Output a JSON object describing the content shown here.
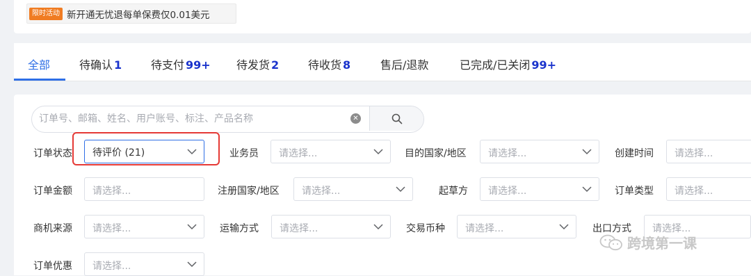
{
  "promo": {
    "badge": "限时活动",
    "text": "新开通无忧退每单保费仅0.01美元"
  },
  "tabs": [
    {
      "label": "全部",
      "count": ""
    },
    {
      "label": "待确认",
      "count": "1"
    },
    {
      "label": "待支付",
      "count": "99+"
    },
    {
      "label": "待发货",
      "count": "2"
    },
    {
      "label": "待收货",
      "count": "8"
    },
    {
      "label": "售后/退款",
      "count": ""
    },
    {
      "label": "已完成/已关闭",
      "count": "99+"
    }
  ],
  "search": {
    "placeholder": "订单号、邮箱、姓名、用户账号、标注、产品名称",
    "value": ""
  },
  "select_placeholder": "请选择...",
  "filters": {
    "order_status": {
      "label": "订单状态",
      "value": "待评价 (21)"
    },
    "salesperson": {
      "label": "业务员"
    },
    "destination": {
      "label": "目的国家/地区"
    },
    "created_time": {
      "label": "创建时间"
    },
    "order_amount": {
      "label": "订单金额"
    },
    "reg_country": {
      "label": "注册国家/地区"
    },
    "drafter": {
      "label": "起草方"
    },
    "order_type": {
      "label": "订单类型"
    },
    "lead_source": {
      "label": "商机来源"
    },
    "shipping": {
      "label": "运输方式"
    },
    "currency": {
      "label": "交易币种"
    },
    "export_mode": {
      "label": "出口方式"
    },
    "order_discount": {
      "label": "订单优惠"
    }
  },
  "watermark": "跨境第一课",
  "colors": {
    "accent": "#2f6fe6",
    "count": "#1a33cc",
    "highlight": "#e53935",
    "badge": "#f07c22"
  }
}
